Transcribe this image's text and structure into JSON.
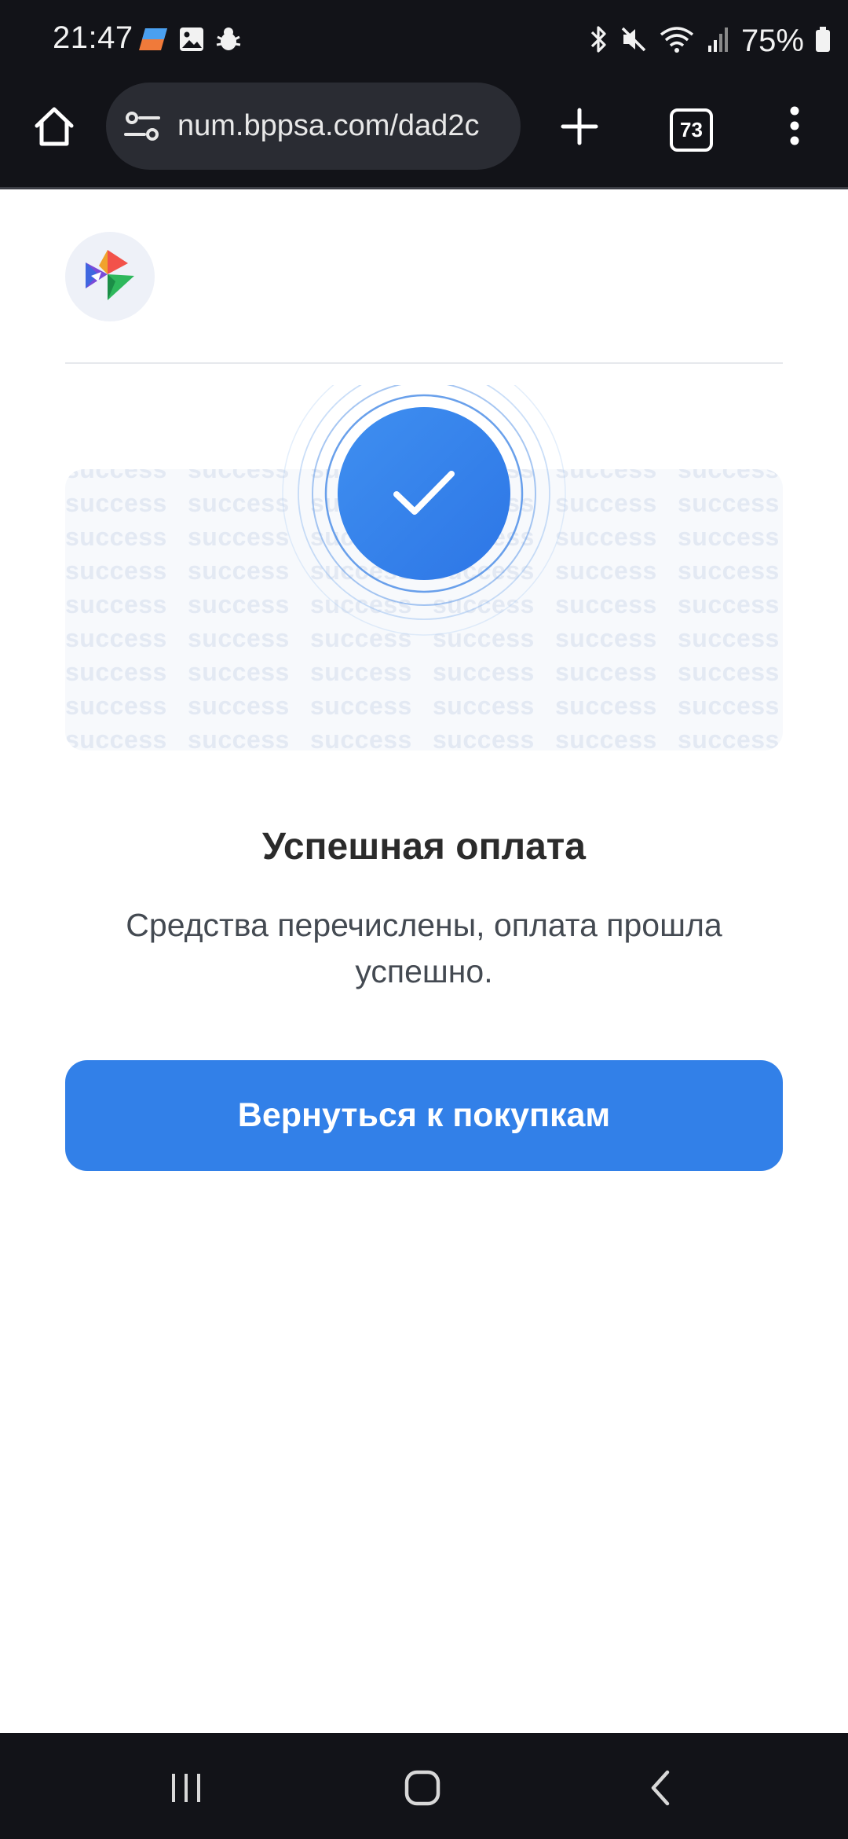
{
  "status_bar": {
    "time": "21:47",
    "left_icons": [
      "app-notification-icon",
      "image-icon",
      "bug-icon"
    ],
    "right_icons": [
      "bluetooth-icon",
      "mute-icon",
      "wifi-icon",
      "signal-icon",
      "battery-icon"
    ],
    "battery_percent": "75%"
  },
  "browser": {
    "url": "num.bppsa.com/dad2c",
    "tab_count": "73",
    "icons": [
      "home-icon",
      "site-settings-icon",
      "new-tab-icon",
      "tabs-icon",
      "menu-icon"
    ]
  },
  "page": {
    "logo": "bppsa-logo",
    "pattern_word": "success",
    "title": "Успешная оплата",
    "subtitle": "Средства перечислены, оплата прошла успешно.",
    "cta_label": "Вернуться к покупкам",
    "accent_color": "#3280e8"
  },
  "nav_bar": {
    "icons": [
      "recent-apps-icon",
      "home-nav-icon",
      "back-icon"
    ]
  }
}
